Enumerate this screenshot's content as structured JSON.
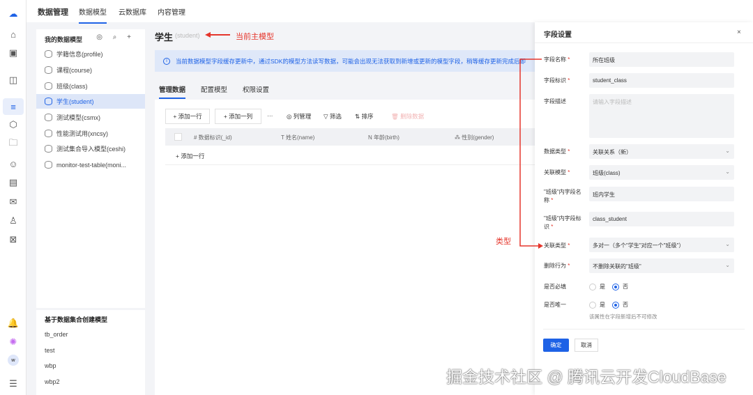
{
  "topnav": {
    "brand": "数据管理",
    "tabs": [
      "数据模型",
      "云数据库",
      "内容管理"
    ]
  },
  "models": {
    "title": "我的数据模型",
    "tools": "◎ ⌕ +",
    "items": [
      "学籍信息(profile)",
      "课程(course)",
      "班级(class)",
      "学生(student)",
      "测试模型(csmx)",
      "性能测试用(xncsy)",
      "测试集合导入模型(ceshi)",
      "monitor-test-table(moni..."
    ],
    "active_index": 3,
    "collection_title": "基于数据集合创建模型",
    "collection_items": [
      "tb_order",
      "test",
      "wbp",
      "wbp2"
    ]
  },
  "main": {
    "title": "学生",
    "subtitle": "(student)",
    "annotation_main": "当前主模型",
    "annotation_type": "类型",
    "banner": "当前数据模型字段缓存更新中，通过SDK的模型方法读写数据，可能会出现无法获取到新增或更新的模型字段，稍等缓存更新完成后即",
    "tabs": [
      "管理数据",
      "配置模型",
      "权限设置"
    ],
    "toolbar": {
      "add_row": "+ 添加一行",
      "add_col": "+ 添加一列",
      "more": "···",
      "columns": "列管理",
      "filter": "筛选",
      "sort": "排序",
      "delete": "删除数据"
    },
    "columns": [
      "# 数据标识(_id)",
      "姓名(name)",
      "年龄(birth)",
      "性别(gender)"
    ],
    "add_row_inline": "+ 添加一行"
  },
  "drawer": {
    "title": "字段设置",
    "close": "×",
    "fields": {
      "name_label": "字段名称",
      "name_value": "所在班级",
      "id_label": "字段标识",
      "id_value": "student_class",
      "desc_label": "字段描述",
      "desc_placeholder": "请输入字段描述",
      "type_label": "数据类型",
      "type_value": "关联关系（新）",
      "model_label": "关联模型",
      "model_value": "班级(class)",
      "inner_name_label": "\"班级\"内字段名称",
      "inner_name_value": "班内学生",
      "inner_id_label": "\"班级\"内字段标识",
      "inner_id_value": "class_student",
      "rel_label": "关联类型",
      "rel_value": "多对一（多个\"学生\"对应一个\"班级\"）",
      "del_label": "删除行为",
      "del_value": "不删除关联的\"班级\"",
      "required_label": "是否必填",
      "unique_label": "是否唯一",
      "yes": "是",
      "no": "否",
      "required": "否",
      "unique": "否",
      "hint": "该属性在字段新增后不可修改"
    },
    "ok": "确定",
    "cancel": "取消"
  },
  "watermark": "掘金技术社区 @ 腾讯云开发CloudBase",
  "colors": {
    "accent": "#1e62e6",
    "annotation": "#e5352b"
  }
}
